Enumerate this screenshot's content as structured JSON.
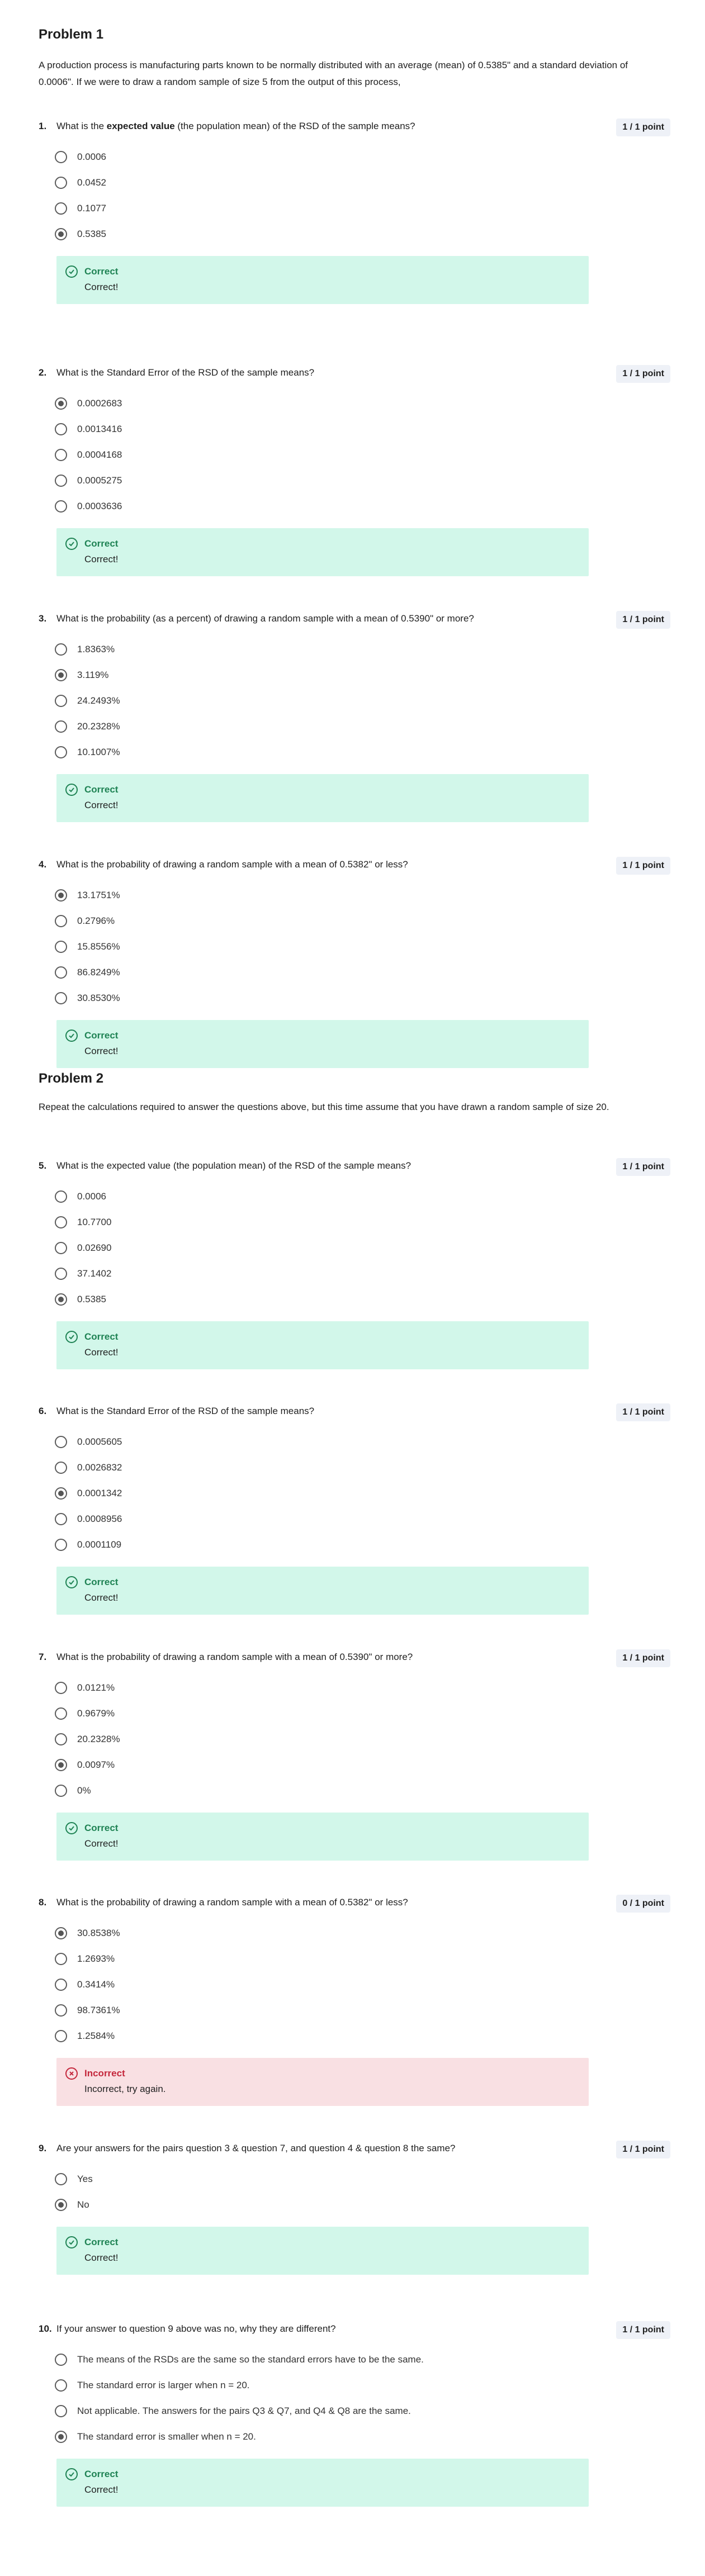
{
  "problem1": {
    "title": "Problem 1",
    "intro": "A production process is manufacturing parts known to be normally distributed with an average (mean) of 0.5385\" and a standard deviation of 0.0006\". If we were to draw a random sample of size 5 from the output of this process,"
  },
  "problem2": {
    "title": "Problem 2",
    "intro": "Repeat the calculations required to answer the questions above, but this time assume that you have drawn a random sample of size 20."
  },
  "questions": [
    {
      "num": "1.",
      "text_pre": "What is the ",
      "text_bold": "expected value",
      "text_post": " (the population mean) of the RSD of the sample means?",
      "points": "1 / 1 point",
      "options": [
        "0.0006",
        "0.0452",
        "0.1077",
        "0.5385"
      ],
      "selected": 3,
      "feedback": {
        "status": "Correct",
        "message": "Correct!",
        "result": "correct"
      }
    },
    {
      "num": "2.",
      "text_pre": "What is the Standard Error of the RSD of the sample means?",
      "text_bold": "",
      "text_post": "",
      "points": "1 / 1 point",
      "options": [
        "0.0002683",
        "0.0013416",
        "0.0004168",
        "0.0005275",
        "0.0003636"
      ],
      "selected": 0,
      "feedback": {
        "status": "Correct",
        "message": "Correct!",
        "result": "correct"
      }
    },
    {
      "num": "3.",
      "text_pre": "What is the probability (as a percent) of drawing a random sample with a mean of 0.5390\" or more?",
      "text_bold": "",
      "text_post": "",
      "points": "1 / 1 point",
      "options": [
        "1.8363%",
        "3.119%",
        "24.2493%",
        "20.2328%",
        "10.1007%"
      ],
      "selected": 1,
      "feedback": {
        "status": "Correct",
        "message": "Correct!",
        "result": "correct"
      }
    },
    {
      "num": "4.",
      "text_pre": "What is the probability of drawing a random sample with a mean of 0.5382\" or less?",
      "text_bold": "",
      "text_post": "",
      "points": "1 / 1 point",
      "options": [
        "13.1751%",
        "0.2796%",
        "15.8556%",
        "86.8249%",
        "30.8530%"
      ],
      "selected": 0,
      "feedback": {
        "status": "Correct",
        "message": "Correct!",
        "result": "correct"
      }
    },
    {
      "num": "5.",
      "text_pre": "What is the expected value (the population mean) of the RSD of the sample means?",
      "text_bold": "",
      "text_post": "",
      "points": "1 / 1 point",
      "options": [
        "0.0006",
        "10.7700",
        "0.02690",
        "37.1402",
        "0.5385"
      ],
      "selected": 4,
      "feedback": {
        "status": "Correct",
        "message": "Correct!",
        "result": "correct"
      }
    },
    {
      "num": "6.",
      "text_pre": "What is the Standard Error of the RSD of the sample means?",
      "text_bold": "",
      "text_post": "",
      "points": "1 / 1 point",
      "options": [
        "0.0005605",
        "0.0026832",
        "0.0001342",
        "0.0008956",
        "0.0001109"
      ],
      "selected": 2,
      "feedback": {
        "status": "Correct",
        "message": "Correct!",
        "result": "correct"
      }
    },
    {
      "num": "7.",
      "text_pre": "What is the probability of drawing a random sample with a mean of 0.5390\" or more?",
      "text_bold": "",
      "text_post": "",
      "points": "1 / 1 point",
      "options": [
        "0.0121%",
        "0.9679%",
        "20.2328%",
        "0.0097%",
        "0%"
      ],
      "selected": 3,
      "feedback": {
        "status": "Correct",
        "message": "Correct!",
        "result": "correct"
      }
    },
    {
      "num": "8.",
      "text_pre": "What is the probability of drawing a random sample with a mean of 0.5382\" or less?",
      "text_bold": "",
      "text_post": "",
      "points": "0 / 1 point",
      "options": [
        "30.8538%",
        "1.2693%",
        "0.3414%",
        "98.7361%",
        "1.2584%"
      ],
      "selected": 0,
      "feedback": {
        "status": "Incorrect",
        "message": "Incorrect, try again.",
        "result": "incorrect"
      }
    },
    {
      "num": "9.",
      "text_pre": "Are your answers for the pairs question 3 & question 7, and question 4 & question 8 the same?",
      "text_bold": "",
      "text_post": "",
      "points": "1 / 1 point",
      "options": [
        "Yes",
        "No"
      ],
      "selected": 1,
      "feedback": {
        "status": "Correct",
        "message": "Correct!",
        "result": "correct"
      }
    },
    {
      "num": "10.",
      "text_pre": "If your answer to question 9 above was no, why they are different?",
      "text_bold": "",
      "text_post": "",
      "points": "1 / 1 point",
      "options": [
        "The means of the RSDs are the same so the standard errors have to be the same.",
        "The standard error is larger when n = 20.",
        "Not applicable. The answers for the pairs Q3 & Q7, and Q4 & Q8 are the same.",
        "The standard error is smaller when n = 20."
      ],
      "selected": 3,
      "feedback": {
        "status": "Correct",
        "message": "Correct!",
        "result": "correct"
      }
    }
  ]
}
